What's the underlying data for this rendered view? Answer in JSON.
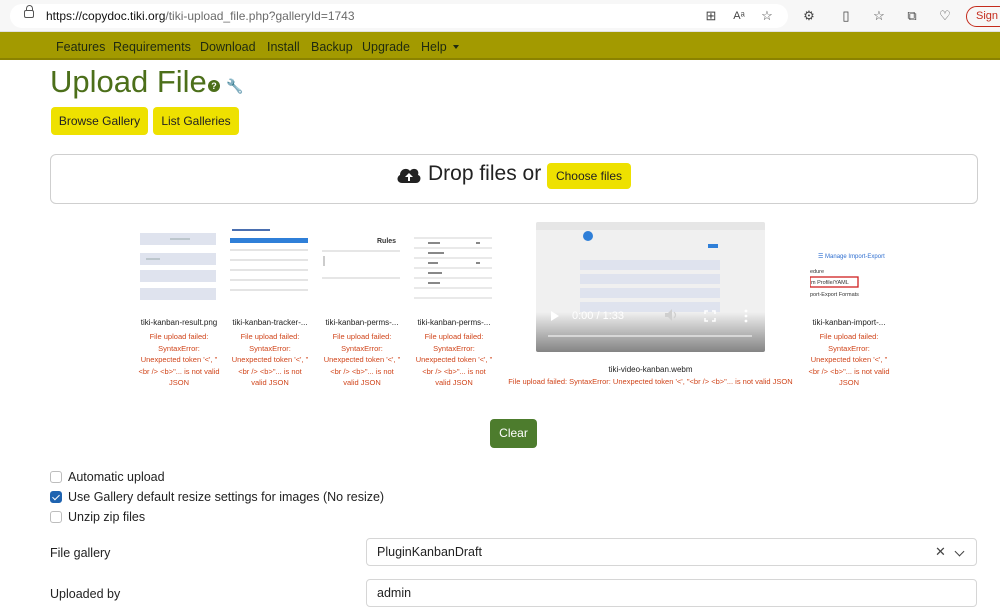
{
  "browser": {
    "url_host": "https://copydoc.tiki.org",
    "url_path": "/tiki-upload_file.php?galleryId=1743",
    "sign_in_label": "Sign in"
  },
  "nav": {
    "items": [
      "Features",
      "Requirements",
      "Download",
      "Install",
      "Backup",
      "Upgrade",
      "Help"
    ]
  },
  "page": {
    "title": "Upload File",
    "browse_gallery_label": "Browse Gallery",
    "list_galleries_label": "List Galleries"
  },
  "dropzone": {
    "text": "Drop files or",
    "choose_label": "Choose files"
  },
  "files": [
    {
      "name": "tiki-kanban-result.png",
      "error": "File upload failed: SyntaxError: Unexpected token '<', \"<br /> <b>\"... is not valid JSON"
    },
    {
      "name": "tiki-kanban-tracker-...",
      "error": "File upload failed: SyntaxError: Unexpected token '<', \"<br /> <b>\"... is not valid JSON"
    },
    {
      "name": "tiki-kanban-perms-...",
      "error": "File upload failed: SyntaxError: Unexpected token '<', \"<br /> <b>\"... is not valid JSON"
    },
    {
      "name": "tiki-kanban-perms-...",
      "error": "File upload failed: SyntaxError: Unexpected token '<', \"<br /> <b>\"... is not valid JSON"
    },
    {
      "name": "tiki-video-kanban.webm",
      "error": "File upload failed: SyntaxError: Unexpected token '<', \"<br /> <b>\"... is not valid JSON"
    },
    {
      "name": "tiki-kanban-import-...",
      "error": "File upload failed: SyntaxError: Unexpected token '<', \"<br /> <b>\"... is not valid JSON"
    }
  ],
  "video": {
    "time": "0:00 / 1:33",
    "playback_progress": 0
  },
  "clear_label": "Clear",
  "options": {
    "automatic_upload": {
      "label": "Automatic upload",
      "checked": false
    },
    "resize": {
      "label": "Use Gallery default resize settings for images (No resize)",
      "checked": true
    },
    "unzip": {
      "label": "Unzip zip files",
      "checked": false
    }
  },
  "form": {
    "file_gallery_label": "File gallery",
    "file_gallery_value": "PluginKanbanDraft",
    "uploaded_by_label": "Uploaded by",
    "uploaded_by_value": "admin"
  },
  "colors": {
    "nav_bg": "#a39a00",
    "title": "#4c6f1a",
    "yellow_button": "#eee100",
    "clear_button": "#4d7c2d",
    "error_text": "#d0451b",
    "checkbox_checked": "#1e63b0"
  },
  "icons": [
    "lock-icon",
    "help-icon",
    "wrench-icon",
    "cloud-upload-icon",
    "play-icon",
    "volume-icon",
    "fullscreen-icon",
    "more-icon",
    "close-icon",
    "chevron-down-icon"
  ]
}
